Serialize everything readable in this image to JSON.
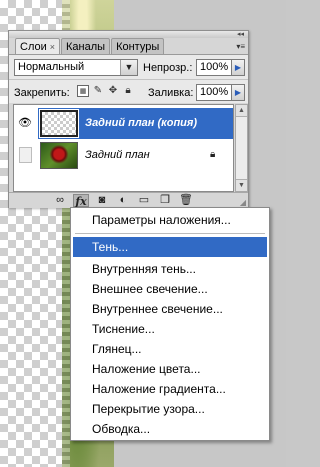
{
  "tabs": [
    {
      "label": "Слои",
      "close": "×"
    },
    {
      "label": "Каналы"
    },
    {
      "label": "Контуры"
    }
  ],
  "panel_menu_icon": "▾≡",
  "collapse_icon": "◂◂",
  "blend_mode": {
    "value": "Нормальный"
  },
  "opacity": {
    "label": "Непрозр.:",
    "value": "100%"
  },
  "lock": {
    "label": "Закрепить:",
    "icons": [
      "lock-transparent-icon",
      "brush-icon",
      "move-icon",
      "lock-icon"
    ]
  },
  "fill": {
    "label": "Заливка:",
    "value": "100%"
  },
  "layers": [
    {
      "name": "Задний план (копия)",
      "visible": true,
      "selected": true
    },
    {
      "name": "Задний план",
      "visible": false,
      "locked": true
    }
  ],
  "bottom_tools": [
    "link-icon",
    "fx-icon",
    "mask-icon",
    "adjustment-icon",
    "folder-icon",
    "new-layer-icon",
    "trash-icon"
  ],
  "fx_label": "fx",
  "menu": {
    "items": [
      "Параметры наложения...",
      "Тень...",
      "Внутренняя тень...",
      "Внешнее свечение...",
      "Внутреннее свечение...",
      "Тиснение...",
      "Глянец...",
      "Наложение цвета...",
      "Наложение градиента...",
      "Перекрытие узора...",
      "Обводка..."
    ],
    "highlighted_index": 1
  },
  "colors": {
    "selection": "#316ac5",
    "panel_bg": "#d6d6d6",
    "field_bg": "#ffffff"
  }
}
